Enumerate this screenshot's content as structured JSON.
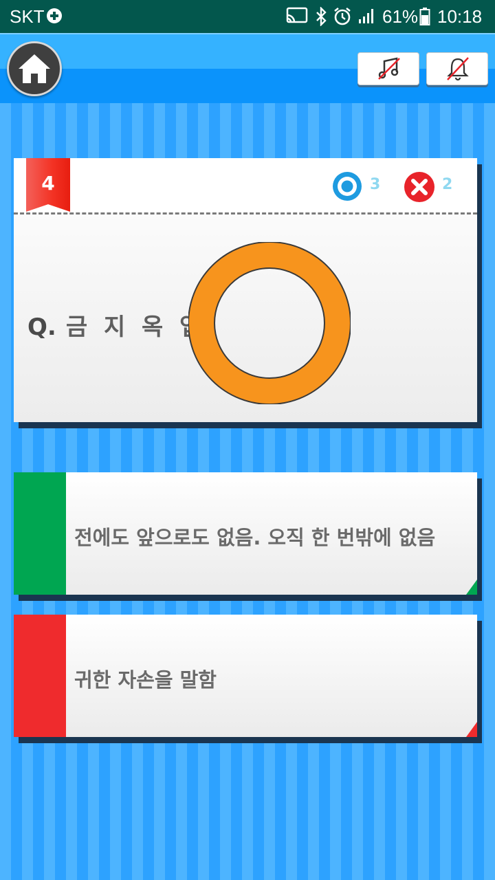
{
  "status_bar": {
    "carrier": "SKT",
    "battery": "61%",
    "time": "10:18",
    "icons": [
      "game-controller-icon",
      "cast-icon",
      "bluetooth-icon",
      "alarm-icon",
      "signal-icon",
      "battery-icon"
    ]
  },
  "toolbar": {
    "home_icon": "home-icon",
    "music_icon": "music-off-icon",
    "notification_icon": "bell-off-icon"
  },
  "question": {
    "number": "4",
    "correct_count": "3",
    "wrong_count": "2",
    "prefix": "Q.",
    "text": "금 지 옥 엽",
    "result_mark": "orange-circle-o-icon"
  },
  "answers": [
    {
      "text": "전에도 앞으로도 없음. 오직 한 번밖에 없음",
      "color": "#00a651"
    },
    {
      "text": "귀한 자손을 말함",
      "color": "#ef2b2d"
    }
  ],
  "colors": {
    "status_bar": "#03574d",
    "top_bar": "#0b93fb",
    "stripe_light": "#4db4ff",
    "stripe_dark": "#2da2ff",
    "ribbon": "#f33224",
    "mark_orange": "#f7941d",
    "correct_blue": "#1e9be0",
    "wrong_red": "#e8232a"
  }
}
